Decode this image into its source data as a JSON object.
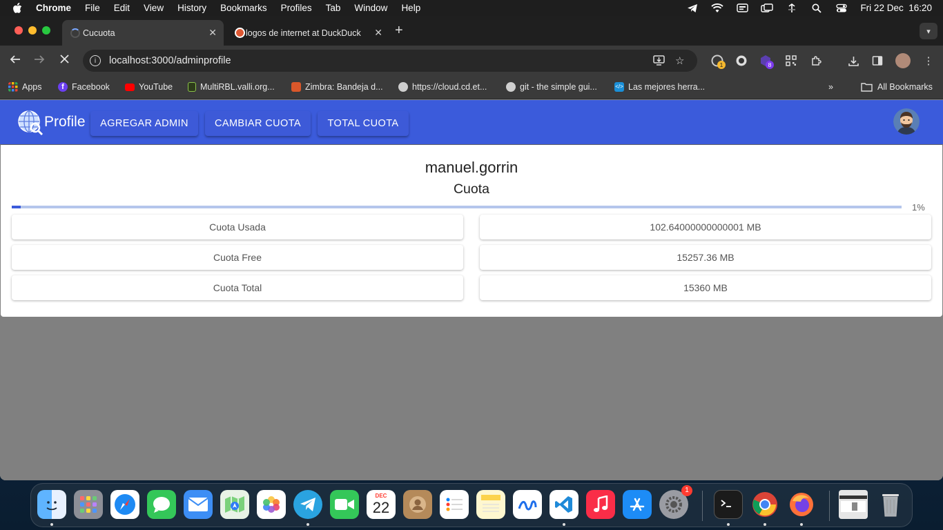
{
  "menubar": {
    "app_name": "Chrome",
    "items": [
      "File",
      "Edit",
      "View",
      "History",
      "Bookmarks",
      "Profiles",
      "Tab",
      "Window",
      "Help"
    ],
    "clock": "Fri 22 Dec  16:20"
  },
  "tabs": [
    {
      "title": "Cucuota",
      "active": true
    },
    {
      "title": "logos de internet at DuckDuck",
      "active": false
    }
  ],
  "toolbar": {
    "url": "localhost:3000/adminprofile",
    "badge_one": "1",
    "badge_two": "8"
  },
  "bookmarks": {
    "items": [
      "Apps",
      "Facebook",
      "YouTube",
      "MultiRBL.valli.org...",
      "Zimbra: Bandeja d...",
      "https://cloud.cd.et...",
      "git - the simple gui...",
      "Las mejores herra..."
    ],
    "all_label": "All Bookmarks"
  },
  "appbar": {
    "brand": "Profile",
    "buttons": [
      "AGREGAR ADMIN",
      "CAMBIAR CUOTA",
      "TOTAL CUOTA"
    ]
  },
  "profile": {
    "username": "manuel.gorrin",
    "subtitle": "Cuota",
    "progress_percent": 1,
    "progress_label": "1%",
    "rows": [
      {
        "label": "Cuota Usada",
        "value": "102.64000000000001 MB"
      },
      {
        "label": "Cuota Free",
        "value": "15257.36 MB"
      },
      {
        "label": "Cuota Total",
        "value": "15360 MB"
      }
    ]
  },
  "dock": {
    "calendar_month": "DEC",
    "calendar_day": "22",
    "settings_badge": "1"
  },
  "colors": {
    "appbar": "#3b5bdb",
    "progress_fill": "#3b5bdb",
    "progress_track": "#b5c6ec"
  }
}
